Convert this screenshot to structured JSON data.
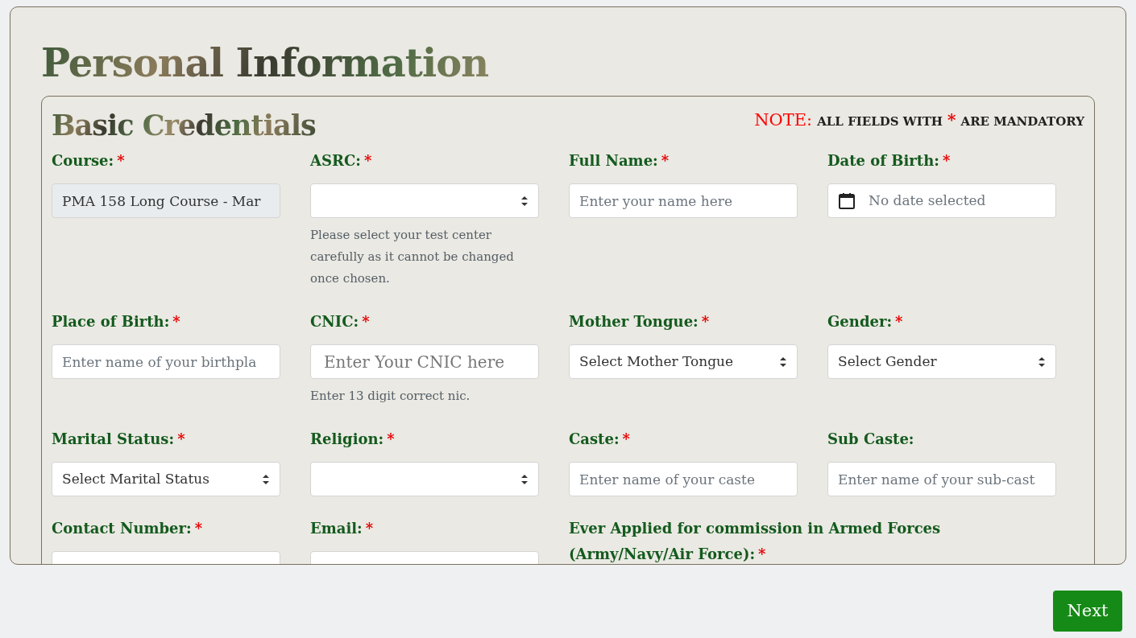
{
  "page_title": "Personal Information",
  "section": {
    "title": "Basic Credentials",
    "note": {
      "prefix": "NOTE:",
      "before": "ALL FIELDS WITH",
      "mark": "*",
      "after": "ARE MANDATORY"
    }
  },
  "fields": [
    {
      "label": "Course:",
      "required": true,
      "kind": "text",
      "value": "PMA 158 Long Course - Mar",
      "disabled": true
    },
    {
      "label": "ASRC:",
      "required": true,
      "kind": "select",
      "help": "Please select your test center carefully as it cannot be changed once chosen."
    },
    {
      "label": "Full Name:",
      "required": true,
      "kind": "text",
      "placeholder": "Enter your name here",
      "disabled": false
    },
    {
      "label": "Date of Birth:",
      "required": true,
      "kind": "date",
      "placeholder": "No date selected"
    },
    {
      "label": "Place of Birth:",
      "required": true,
      "kind": "text",
      "placeholder": "Enter name of your birthpla",
      "disabled": false
    },
    {
      "label": "CNIC:",
      "required": true,
      "kind": "text",
      "placeholder": "Enter Your CNIC here",
      "large": true,
      "disabled": false,
      "help": "Enter 13 digit correct nic."
    },
    {
      "label": "Mother Tongue:",
      "required": true,
      "kind": "select",
      "value": "Select Mother Tongue"
    },
    {
      "label": "Gender:",
      "required": true,
      "kind": "select",
      "value": "Select Gender"
    },
    {
      "label": "Marital Status:",
      "required": true,
      "kind": "select",
      "value": "Select Marital Status"
    },
    {
      "label": "Religion:",
      "required": true,
      "kind": "select"
    },
    {
      "label": "Caste:",
      "required": true,
      "kind": "text",
      "placeholder": "Enter name of your caste",
      "disabled": false
    },
    {
      "label": "Sub Caste:",
      "required": false,
      "kind": "text",
      "placeholder": "Enter name of your sub-cast",
      "disabled": false
    },
    {
      "label": "Contact Number:",
      "required": true,
      "kind": "text",
      "disabled": false
    },
    {
      "label": "Email:",
      "required": true,
      "kind": "text",
      "disabled": false
    },
    {
      "label": "Ever Applied for commission in Armed Forces (Army/Navy/Air Force):",
      "required": true,
      "kind": "heading"
    }
  ],
  "next_button": "Next"
}
